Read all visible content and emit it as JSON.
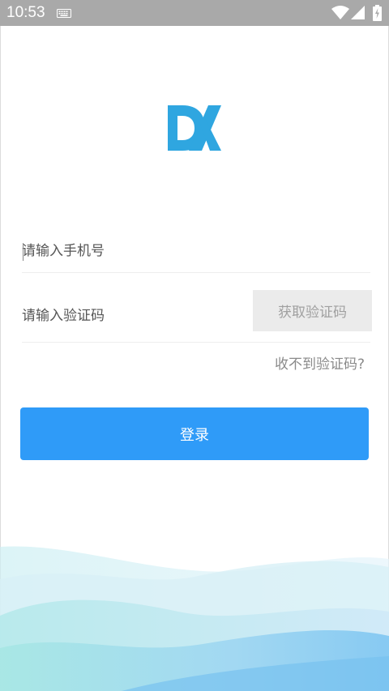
{
  "status_bar": {
    "time": "10:53",
    "icons": [
      "keyboard-icon",
      "wifi-icon",
      "signal-icon",
      "battery-charging-icon"
    ],
    "background": "#a9a9a9"
  },
  "logo": {
    "icon": "dx-logo",
    "color": "#2fa6e0"
  },
  "form": {
    "phone_placeholder": "请输入手机号",
    "code_placeholder": "请输入验证码",
    "get_code_label": "获取验证码",
    "no_code_link": "收不到验证码?",
    "login_label": "登录"
  },
  "colors": {
    "accent": "#2f9bf8",
    "code_button_bg": "#ebebeb",
    "code_button_text": "#a0a0a0"
  }
}
